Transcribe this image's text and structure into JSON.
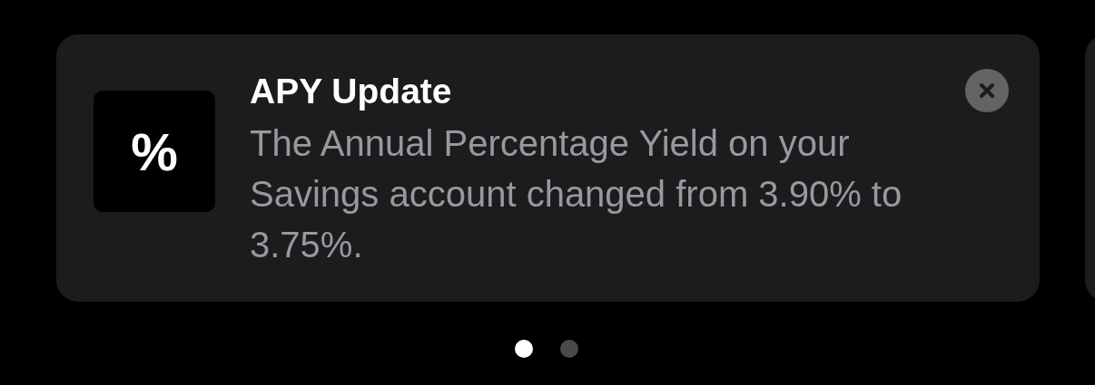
{
  "notifications": [
    {
      "icon_text": "%",
      "title": "APY Update",
      "body": "The Annual Percentage Yield on your Savings account changed from 3.90% to 3.75%."
    }
  ],
  "page_dots": [
    {
      "selected": true
    },
    {
      "selected": false
    }
  ]
}
